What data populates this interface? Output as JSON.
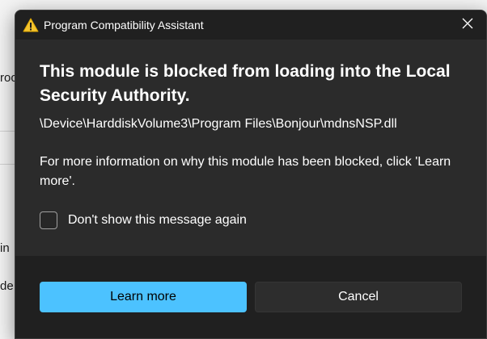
{
  "window": {
    "title": "Program Compatibility Assistant",
    "title_icon": "warning-icon",
    "close_icon": "close-icon"
  },
  "message": {
    "heading": "This module is blocked from loading into the Local Security Authority.",
    "path": "\\Device\\HarddiskVolume3\\Program Files\\Bonjour\\mdnsNSP.dll",
    "info": "For more information on why this module has been blocked, click 'Learn more'."
  },
  "checkbox": {
    "label": "Don't show this message again",
    "checked": false
  },
  "buttons": {
    "learn_more": "Learn more",
    "cancel": "Cancel"
  },
  "background": {
    "fragments": [
      "roo",
      "in",
      "de"
    ]
  },
  "colors": {
    "accent": "#4cc2ff",
    "warning": "#f4c430",
    "dialog_bg": "#2b2b2b",
    "titlebar_bg": "#202020"
  }
}
